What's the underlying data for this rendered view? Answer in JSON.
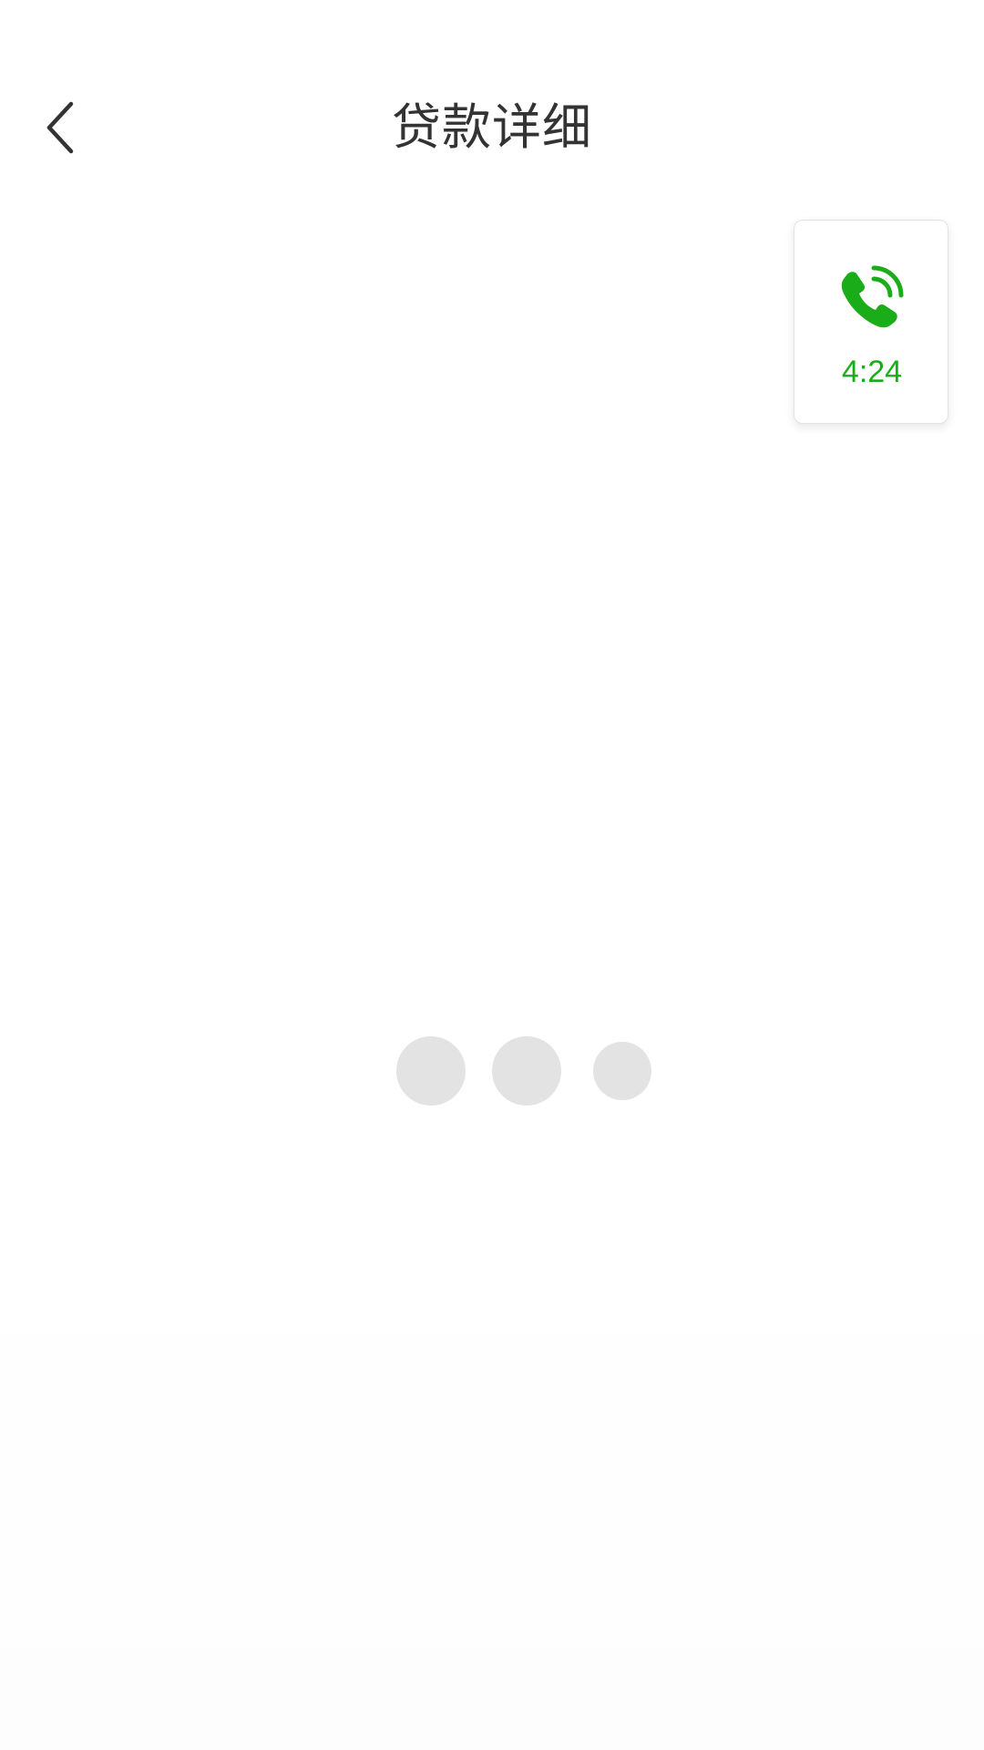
{
  "header": {
    "title": "贷款详细",
    "back_icon": "chevron-left-icon"
  },
  "call_widget": {
    "icon": "phone-ringing-icon",
    "timer": "4:24",
    "accent_color": "#1aad19"
  },
  "loading": {
    "dot_count": 3,
    "dot_color": "#e3e3e3"
  }
}
